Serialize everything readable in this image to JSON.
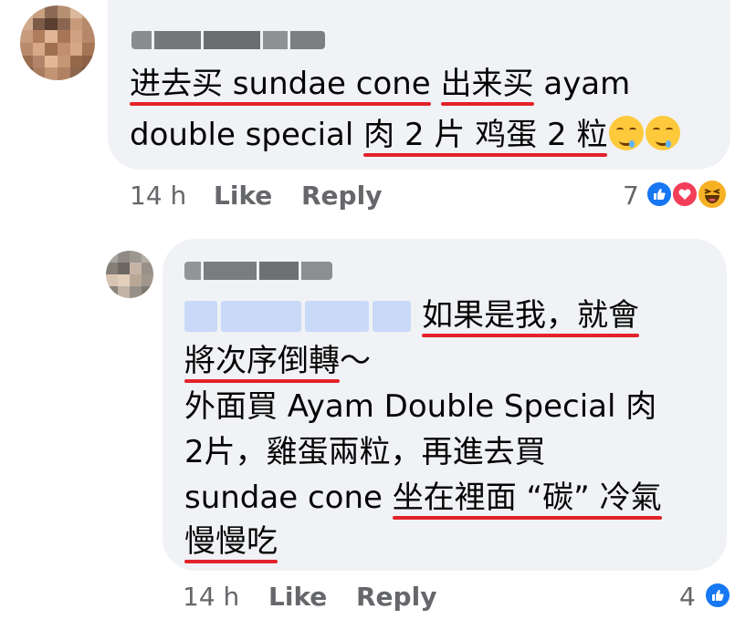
{
  "comments": [
    {
      "text_line1_parts": [
        "进去买 sundae cone",
        " ",
        "出来买",
        " ayam"
      ],
      "text_line2_parts": [
        "double special ",
        "肉 2 片 鸡蛋 2 粒"
      ],
      "time": "14 h",
      "like_label": "Like",
      "reply_label": "Reply",
      "reaction_count": "7",
      "reactions": [
        "like-icon",
        "love-icon",
        "haha-icon"
      ]
    },
    {
      "line1": "如果是我，就會",
      "line2a": "將次序倒轉",
      "line2b": "～",
      "line3": "外面買 Ayam Double Special 肉",
      "line4": "2片，雞蛋兩粒，再進去買",
      "line5a": "sundae cone ",
      "line5b": "坐在裡面 “碳” 冷氣",
      "line6": "慢慢吃",
      "time": "14 h",
      "like_label": "Like",
      "reply_label": "Reply",
      "reaction_count": "4",
      "reactions": [
        "like-icon"
      ]
    }
  ],
  "colors": {
    "bubble": "#f0f2f5",
    "underline": "#e3222a",
    "meta": "#65676b",
    "like": "#1877f2",
    "love": "#f33e58",
    "haha": "#f7b125"
  }
}
